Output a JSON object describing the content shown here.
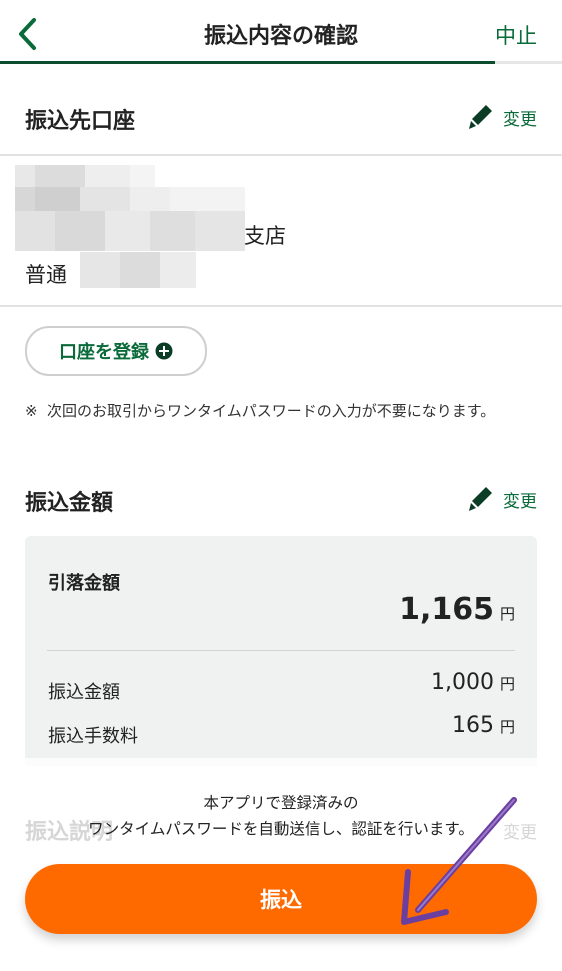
{
  "header": {
    "title": "振込内容の確認",
    "cancel_label": "中止",
    "progress_fraction": 0.88
  },
  "account_section": {
    "title": "振込先口座",
    "edit_label": "変更",
    "branch_suffix": "支店",
    "account_type": "普通"
  },
  "register": {
    "label": "口座を登録"
  },
  "note": {
    "mark": "※",
    "text": "次回のお取引からワンタイムパスワードの入力が不要になります。"
  },
  "amount_section": {
    "title": "振込金額",
    "edit_label": "変更",
    "debit_label": "引落金額",
    "debit_value": "1,165",
    "transfer_label": "振込金額",
    "transfer_value": "1,000",
    "fee_label": "振込手数料",
    "fee_value": "165",
    "currency": "円"
  },
  "bottom": {
    "ghost_title": "振込説明",
    "ghost_edit": "変更",
    "info_line1": "本アプリで登録済みの",
    "info_line2": "ワンタイムパスワードを自動送信し、認証を行います。",
    "submit_label": "振込"
  },
  "colors": {
    "accent_green": "#0a6a3a",
    "progress_green": "#0b4d2e",
    "submit_orange": "#ff6a00",
    "annotation_purple": "#6b3fa0"
  },
  "icons": {
    "back": "chevron-left-icon",
    "edit": "pencil-icon",
    "register": "plus-circle-icon",
    "annotation": "arrow-annotation"
  }
}
